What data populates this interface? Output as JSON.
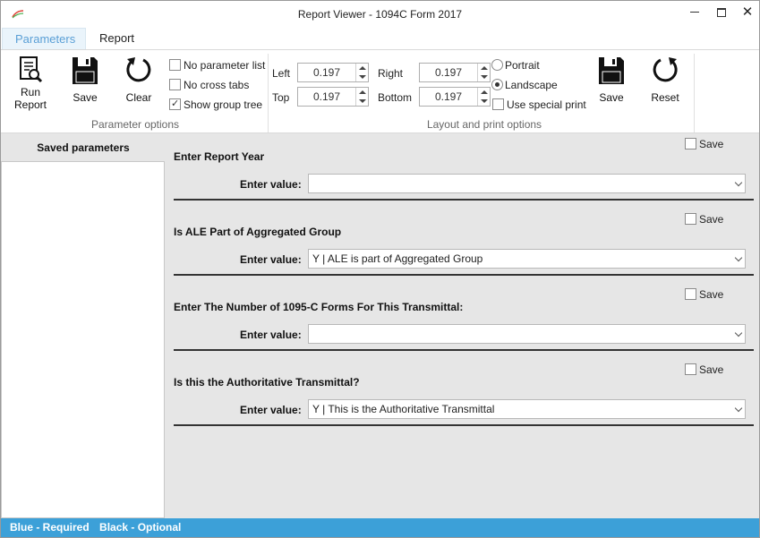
{
  "window": {
    "title": "Report Viewer - 1094C Form 2017",
    "minimize": "—",
    "maximize": "",
    "close": "✕"
  },
  "tabs": [
    {
      "label": "Parameters",
      "active": true
    },
    {
      "label": "Report",
      "active": false
    }
  ],
  "ribbon": {
    "parameter_options": {
      "group_label": "Parameter options",
      "buttons": [
        {
          "label": "Run\nReport",
          "line1": "Run",
          "line2": "Report",
          "icon": "run-report-icon"
        },
        {
          "label": "Save",
          "icon": "save-icon"
        },
        {
          "label": "Clear",
          "icon": "clear-icon"
        }
      ],
      "checkboxes": [
        {
          "label": "No parameter list",
          "checked": false
        },
        {
          "label": "No cross tabs",
          "checked": false
        },
        {
          "label": "Show group tree",
          "checked": true
        }
      ]
    },
    "layout_options": {
      "group_label": "Layout and print options",
      "margins": {
        "left_label": "Left",
        "left_value": "0.197",
        "top_label": "Top",
        "top_value": "0.197",
        "right_label": "Right",
        "right_value": "0.197",
        "bottom_label": "Bottom",
        "bottom_value": "0.197"
      },
      "orientation": [
        {
          "label": "Portrait",
          "selected": false
        },
        {
          "label": "Landscape",
          "selected": true
        }
      ],
      "special_print": {
        "label": "Use special print",
        "checked": false
      },
      "buttons": [
        {
          "label": "Save",
          "icon": "save-icon"
        },
        {
          "label": "Reset",
          "icon": "reset-icon"
        }
      ]
    }
  },
  "saved_parameters": {
    "title": "Saved parameters",
    "items": []
  },
  "parameters": [
    {
      "title": "Enter Report Year",
      "enter_label": "Enter value:",
      "value": "",
      "save_label": "Save",
      "save_checked": false
    },
    {
      "title": "Is ALE Part of Aggregated Group",
      "enter_label": "Enter value:",
      "value": "Y | ALE is part of Aggregated Group",
      "save_label": "Save",
      "save_checked": false
    },
    {
      "title": "Enter The Number of 1095-C Forms For This Transmittal:",
      "enter_label": "Enter value:",
      "value": "",
      "save_label": "Save",
      "save_checked": false
    },
    {
      "title": "Is this the Authoritative Transmittal?",
      "enter_label": "Enter value:",
      "value": "Y | This is the Authoritative Transmittal",
      "save_label": "Save",
      "save_checked": false
    }
  ],
  "status": {
    "required": "Blue - Required",
    "optional": "Black - Optional",
    "color": "#3ca0d8"
  }
}
